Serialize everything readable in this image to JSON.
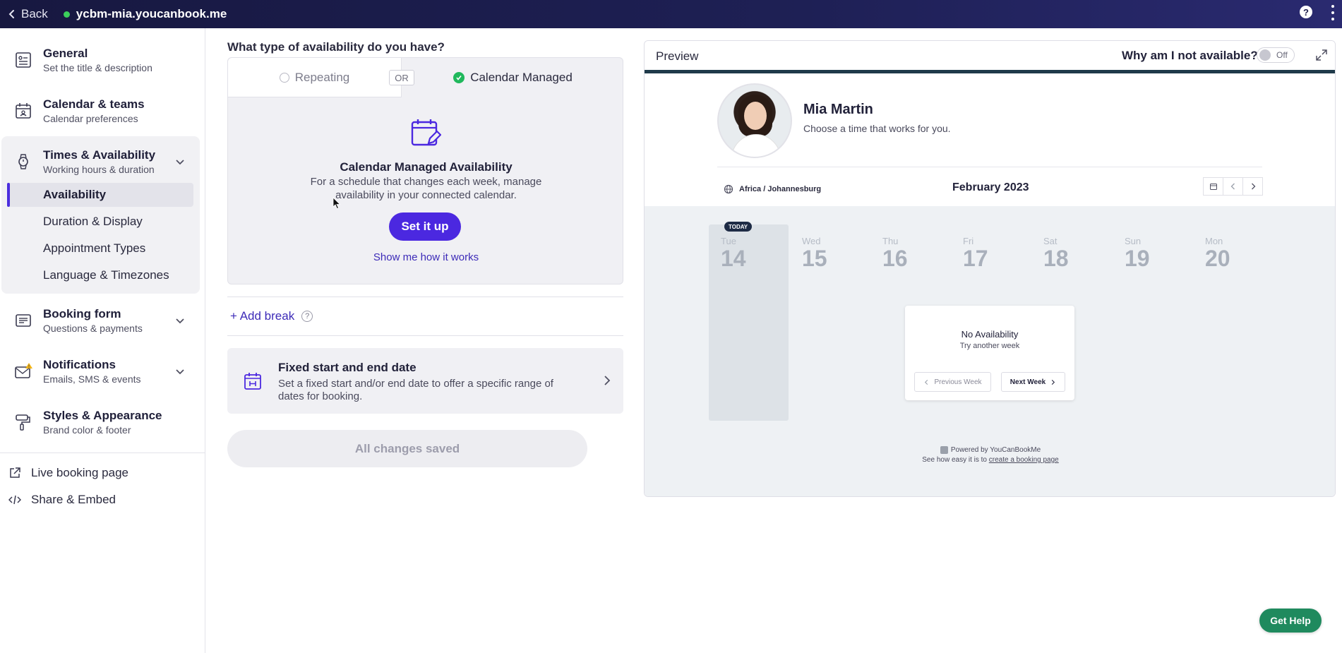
{
  "topbar": {
    "back_label": "Back",
    "site": "ycbm-mia.youcanbook.me",
    "status_color": "#3bcf5b",
    "help_label": "?"
  },
  "sidebar": {
    "items": [
      {
        "title": "General",
        "sub": "Set the title & description",
        "icon": "document-icon"
      },
      {
        "title": "Calendar & teams",
        "sub": "Calendar preferences",
        "icon": "calendar-icon"
      },
      {
        "title": "Times & Availability",
        "sub": "Working hours & duration",
        "icon": "watch-icon"
      },
      {
        "title": "Booking form",
        "sub": "Questions & payments",
        "icon": "form-icon"
      },
      {
        "title": "Notifications",
        "sub": "Emails, SMS & events",
        "icon": "mail-icon"
      },
      {
        "title": "Styles & Appearance",
        "sub": "Brand color & footer",
        "icon": "paint-roller-icon"
      }
    ],
    "sub_items": [
      "Availability",
      "Duration & Display",
      "Appointment Types",
      "Language & Timezones"
    ],
    "links": [
      {
        "label": "Live booking page",
        "icon": "external-link-icon"
      },
      {
        "label": "Share & Embed",
        "icon": "code-icon"
      }
    ]
  },
  "main": {
    "question": "What type of availability do you have?",
    "tab_repeating": "Repeating",
    "or_label": "OR",
    "tab_managed": "Calendar Managed",
    "managed_title": "Calendar Managed Availability",
    "managed_desc": "For a schedule that changes each week, manage availability in your connected calendar.",
    "setup_button": "Set it up",
    "how_link": "Show me how it works",
    "add_break": "+ Add break",
    "fixed_title": "Fixed start and end date",
    "fixed_desc": "Set a fixed start and/or end date to offer a specific range of dates for booking.",
    "saved_label": "All changes saved"
  },
  "preview": {
    "title": "Preview",
    "why_label": "Why am I not available?",
    "toggle_label": "Off",
    "name": "Mia Martin",
    "choose": "Choose a time that works for you.",
    "timezone": "Africa / Johannesburg",
    "month": "February 2023",
    "today_badge": "TODAY",
    "days": [
      {
        "dn": "Tue",
        "dd": "14"
      },
      {
        "dn": "Wed",
        "dd": "15"
      },
      {
        "dn": "Thu",
        "dd": "16"
      },
      {
        "dn": "Fri",
        "dd": "17"
      },
      {
        "dn": "Sat",
        "dd": "18"
      },
      {
        "dn": "Sun",
        "dd": "19"
      },
      {
        "dn": "Mon",
        "dd": "20"
      }
    ],
    "no_avail_title": "No Availability",
    "no_avail_sub": "Try another week",
    "prev_week": "Previous Week",
    "next_week": "Next Week",
    "powered": "Powered by YouCanBookMe",
    "see_how": "See how easy it is to",
    "create_link": "create a booking page",
    "accent_color": "#1f3a4a"
  },
  "get_help": "Get Help",
  "colors": {
    "brand": "#4b28e0",
    "help": "#1f8a5e",
    "success": "#20b85c"
  }
}
